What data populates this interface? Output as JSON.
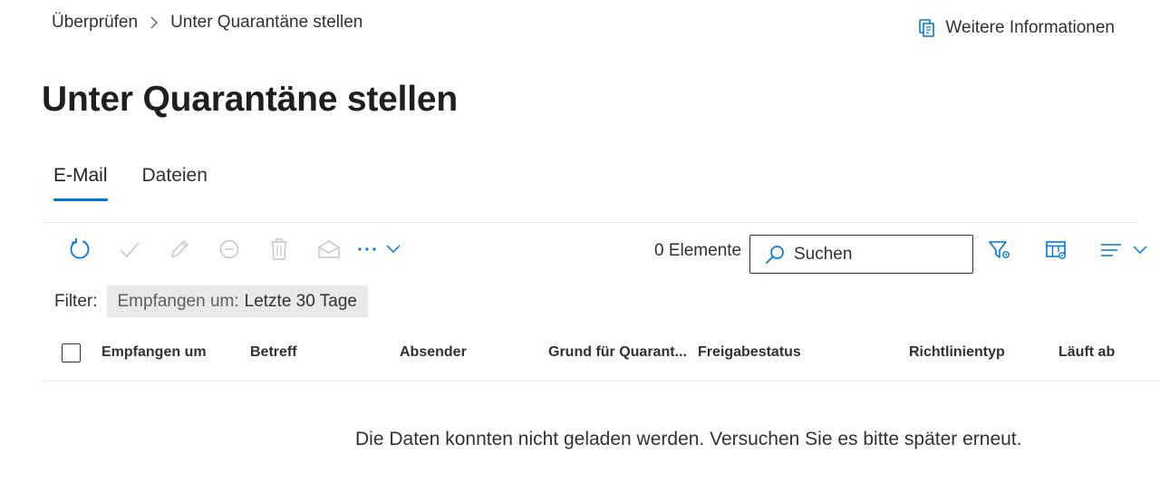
{
  "breadcrumb": {
    "parent": "Überprüfen",
    "current": "Unter Quarantäne stellen"
  },
  "header": {
    "info_link": "Weitere Informationen",
    "title": "Unter Quarantäne stellen"
  },
  "tabs": [
    {
      "label": "E-Mail",
      "active": true
    },
    {
      "label": "Dateien",
      "active": false
    }
  ],
  "toolbar": {
    "icons": [
      "refresh-icon",
      "checkmark-icon",
      "edit-icon",
      "block-icon",
      "delete-icon",
      "mail-read-icon",
      "more-icon"
    ],
    "item_count": "0 Elemente",
    "search_placeholder": "Suchen",
    "right_icons": [
      "filter-icon",
      "column-settings-icon",
      "group-by-icon"
    ]
  },
  "filter": {
    "label": "Filter:",
    "chip_key": "Empfangen um:",
    "chip_value": "Letzte 30 Tage"
  },
  "grid": {
    "columns": [
      "Empfangen um",
      "Betreff",
      "Absender",
      "Grund für Quarant...",
      "Freigabestatus",
      "Richtlinientyp",
      "Läuft ab"
    ],
    "empty_message": "Die Daten konnten nicht geladen werden. Versuchen Sie es bitte später erneut."
  },
  "colors": {
    "accent": "#0078d4",
    "text": "#323130",
    "disabled": "#c8c6c4",
    "chip_bg": "#e9e9e9"
  }
}
